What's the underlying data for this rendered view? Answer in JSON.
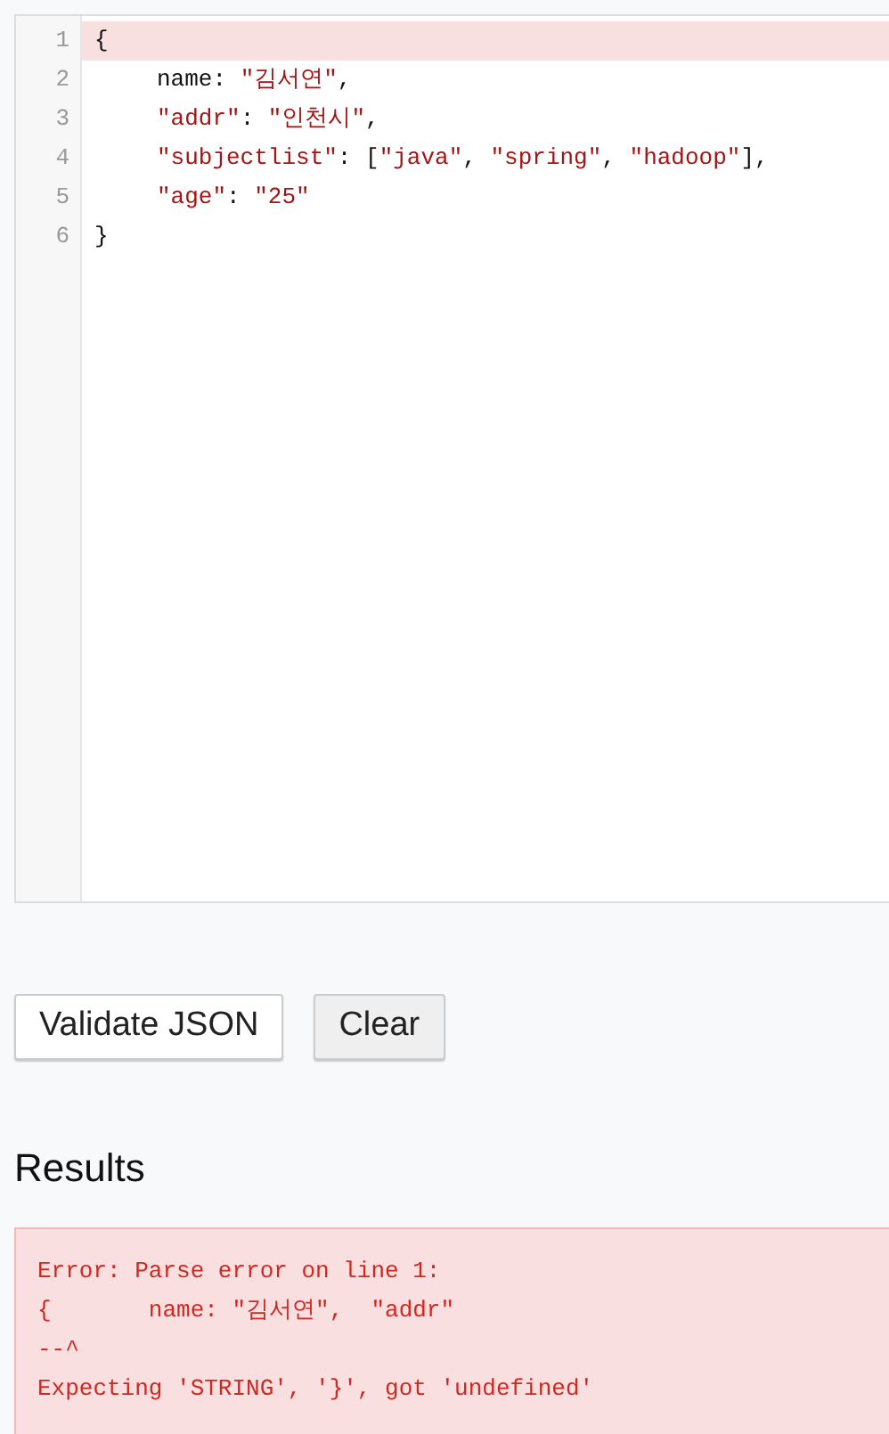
{
  "editor": {
    "lines": [
      {
        "number": "1",
        "error": true,
        "indented": false,
        "tokens": [
          {
            "kind": "plain",
            "text": "{"
          }
        ]
      },
      {
        "number": "2",
        "error": false,
        "indented": true,
        "tokens": [
          {
            "kind": "plain",
            "text": "name: "
          },
          {
            "kind": "string",
            "text": "\"김서연\""
          },
          {
            "kind": "plain",
            "text": ","
          }
        ]
      },
      {
        "number": "3",
        "error": false,
        "indented": true,
        "tokens": [
          {
            "kind": "string",
            "text": "\"addr\""
          },
          {
            "kind": "plain",
            "text": ": "
          },
          {
            "kind": "string",
            "text": "\"인천시\""
          },
          {
            "kind": "plain",
            "text": ","
          }
        ]
      },
      {
        "number": "4",
        "error": false,
        "indented": true,
        "tokens": [
          {
            "kind": "string",
            "text": "\"subjectlist\""
          },
          {
            "kind": "plain",
            "text": ": ["
          },
          {
            "kind": "string",
            "text": "\"java\""
          },
          {
            "kind": "plain",
            "text": ", "
          },
          {
            "kind": "string",
            "text": "\"spring\""
          },
          {
            "kind": "plain",
            "text": ", "
          },
          {
            "kind": "string",
            "text": "\"hadoop\""
          },
          {
            "kind": "plain",
            "text": "],"
          }
        ]
      },
      {
        "number": "5",
        "error": false,
        "indented": true,
        "tokens": [
          {
            "kind": "string",
            "text": "\"age\""
          },
          {
            "kind": "plain",
            "text": ": "
          },
          {
            "kind": "string",
            "text": "\"25\""
          }
        ]
      },
      {
        "number": "6",
        "error": false,
        "indented": false,
        "tokens": [
          {
            "kind": "plain",
            "text": "}"
          }
        ]
      }
    ]
  },
  "buttons": [
    {
      "label": "Validate JSON",
      "kind": "primary"
    },
    {
      "label": "Clear",
      "kind": "secondary"
    }
  ],
  "results": {
    "heading": "Results",
    "lines": [
      "Error: Parse error on line 1:",
      "{       name: \"김서연\",  \"addr\"",
      "--^",
      "Expecting 'STRING', '}', got 'undefined'"
    ]
  }
}
